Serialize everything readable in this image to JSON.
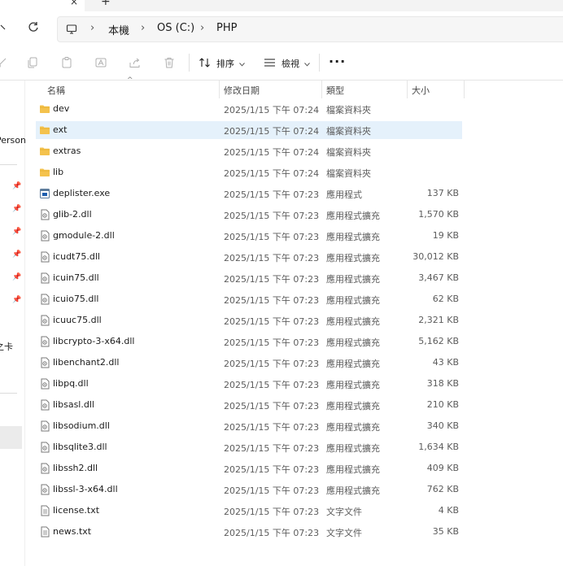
{
  "tabstrip": {
    "close_glyph": "×",
    "new_tab_glyph": "+"
  },
  "address": {
    "pc_icon": "computer-icon",
    "crumbs": [
      "本機",
      "OS (C:)",
      "PHP"
    ]
  },
  "toolbar": {
    "icons": [
      "cut-icon",
      "copy-icon",
      "paste-icon",
      "rename-icon",
      "share-icon",
      "delete-icon"
    ],
    "sort_label": "排序",
    "view_label": "檢視",
    "more_glyph": "···"
  },
  "nav_pane": {
    "items": [
      "Person",
      "之卡"
    ],
    "pinned_count": 6
  },
  "columns": {
    "name": "名稱",
    "date": "修改日期",
    "type": "類型",
    "size": "大小"
  },
  "files": [
    {
      "name": "dev",
      "date": "2025/1/15 下午 07:24",
      "type": "檔案資料夾",
      "size": "",
      "icon": "folder-icon"
    },
    {
      "name": "ext",
      "date": "2025/1/15 下午 07:24",
      "type": "檔案資料夾",
      "size": "",
      "icon": "folder-icon"
    },
    {
      "name": "extras",
      "date": "2025/1/15 下午 07:24",
      "type": "檔案資料夾",
      "size": "",
      "icon": "folder-icon"
    },
    {
      "name": "lib",
      "date": "2025/1/15 下午 07:24",
      "type": "檔案資料夾",
      "size": "",
      "icon": "folder-icon"
    },
    {
      "name": "deplister.exe",
      "date": "2025/1/15 下午 07:23",
      "type": "應用程式",
      "size": "137 KB",
      "icon": "exe-icon"
    },
    {
      "name": "glib-2.dll",
      "date": "2025/1/15 下午 07:23",
      "type": "應用程式擴充",
      "size": "1,570 KB",
      "icon": "dll-icon"
    },
    {
      "name": "gmodule-2.dll",
      "date": "2025/1/15 下午 07:23",
      "type": "應用程式擴充",
      "size": "19 KB",
      "icon": "dll-icon"
    },
    {
      "name": "icudt75.dll",
      "date": "2025/1/15 下午 07:23",
      "type": "應用程式擴充",
      "size": "30,012 KB",
      "icon": "dll-icon"
    },
    {
      "name": "icuin75.dll",
      "date": "2025/1/15 下午 07:23",
      "type": "應用程式擴充",
      "size": "3,467 KB",
      "icon": "dll-icon"
    },
    {
      "name": "icuio75.dll",
      "date": "2025/1/15 下午 07:23",
      "type": "應用程式擴充",
      "size": "62 KB",
      "icon": "dll-icon"
    },
    {
      "name": "icuuc75.dll",
      "date": "2025/1/15 下午 07:23",
      "type": "應用程式擴充",
      "size": "2,321 KB",
      "icon": "dll-icon"
    },
    {
      "name": "libcrypto-3-x64.dll",
      "date": "2025/1/15 下午 07:23",
      "type": "應用程式擴充",
      "size": "5,162 KB",
      "icon": "dll-icon"
    },
    {
      "name": "libenchant2.dll",
      "date": "2025/1/15 下午 07:23",
      "type": "應用程式擴充",
      "size": "43 KB",
      "icon": "dll-icon"
    },
    {
      "name": "libpq.dll",
      "date": "2025/1/15 下午 07:23",
      "type": "應用程式擴充",
      "size": "318 KB",
      "icon": "dll-icon"
    },
    {
      "name": "libsasl.dll",
      "date": "2025/1/15 下午 07:23",
      "type": "應用程式擴充",
      "size": "210 KB",
      "icon": "dll-icon"
    },
    {
      "name": "libsodium.dll",
      "date": "2025/1/15 下午 07:23",
      "type": "應用程式擴充",
      "size": "340 KB",
      "icon": "dll-icon"
    },
    {
      "name": "libsqlite3.dll",
      "date": "2025/1/15 下午 07:23",
      "type": "應用程式擴充",
      "size": "1,634 KB",
      "icon": "dll-icon"
    },
    {
      "name": "libssh2.dll",
      "date": "2025/1/15 下午 07:23",
      "type": "應用程式擴充",
      "size": "409 KB",
      "icon": "dll-icon"
    },
    {
      "name": "libssl-3-x64.dll",
      "date": "2025/1/15 下午 07:23",
      "type": "應用程式擴充",
      "size": "762 KB",
      "icon": "dll-icon"
    },
    {
      "name": "license.txt",
      "date": "2025/1/15 下午 07:23",
      "type": "文字文件",
      "size": "4 KB",
      "icon": "text-file-icon"
    },
    {
      "name": "news.txt",
      "date": "2025/1/15 下午 07:23",
      "type": "文字文件",
      "size": "35 KB",
      "icon": "text-file-icon"
    }
  ],
  "selected_file": "ext",
  "colors": {
    "selection": "#e5f1fb",
    "folder": "#f4c24d",
    "accent": "#0067c0"
  }
}
